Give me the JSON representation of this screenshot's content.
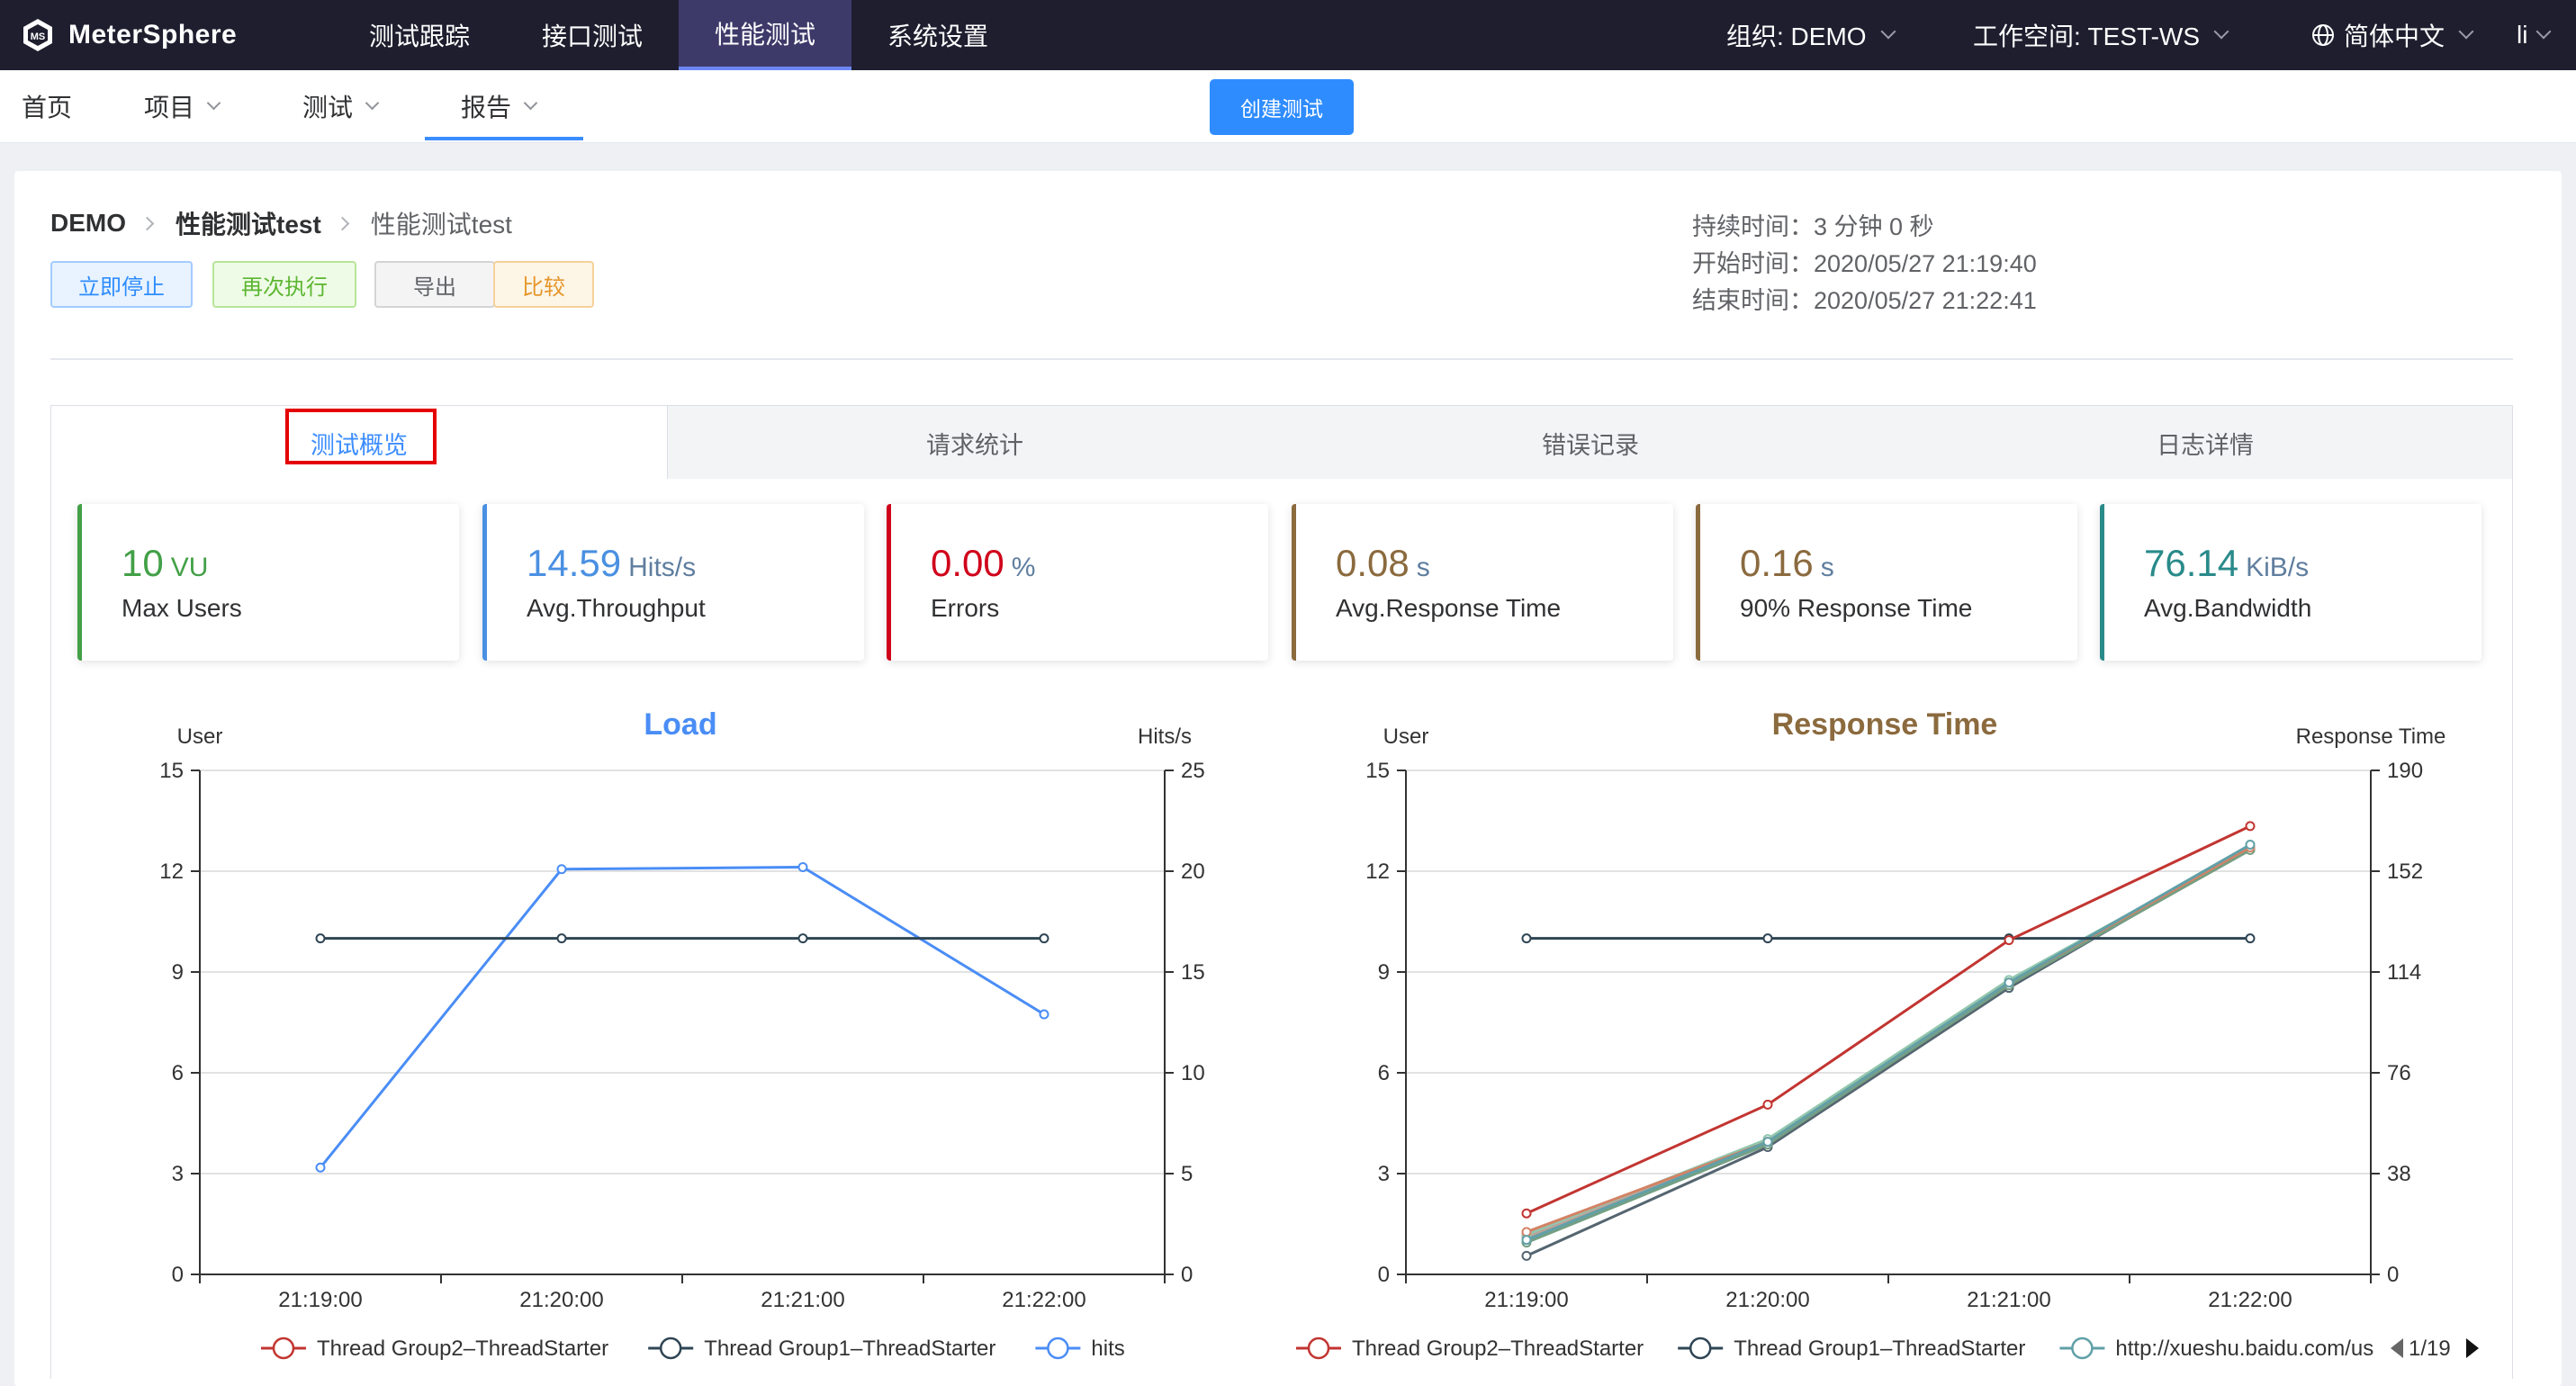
{
  "app": {
    "name": "MeterSphere"
  },
  "topnav": {
    "items": [
      {
        "label": "测试跟踪"
      },
      {
        "label": "接口测试"
      },
      {
        "label": "性能测试"
      },
      {
        "label": "系统设置"
      }
    ],
    "org": "组织: DEMO",
    "workspace": "工作空间: TEST-WS",
    "language": "简体中文",
    "user": "li"
  },
  "subnav": {
    "home": "首页",
    "project": "项目",
    "test": "测试",
    "report": "报告",
    "create": "创建测试"
  },
  "breadcrumb": {
    "project": "DEMO",
    "test": "性能测试test",
    "report": "性能测试test"
  },
  "actions": {
    "stop": "立即停止",
    "rerun": "再次执行",
    "export": "导出",
    "compare": "比较"
  },
  "times": {
    "duration_label": "持续时间：",
    "duration": "3 分钟 0 秒",
    "start_label": "开始时间：",
    "start": "2020/05/27 21:19:40",
    "end_label": "结束时间：",
    "end": "2020/05/27 21:22:41"
  },
  "tabs": [
    {
      "label": "测试概览"
    },
    {
      "label": "请求统计"
    },
    {
      "label": "错误记录"
    },
    {
      "label": "日志详情"
    }
  ],
  "metrics": [
    {
      "value": "10",
      "unit": "VU",
      "label": "Max Users",
      "color": "#43a047"
    },
    {
      "value": "14.59",
      "unit": "Hits/s",
      "label": "Avg.Throughput",
      "color": "#4a90e2"
    },
    {
      "value": "0.00",
      "unit": "%",
      "label": "Errors",
      "color": "#d0021b"
    },
    {
      "value": "0.08",
      "unit": "s",
      "label": "Avg.Response Time",
      "color": "#8b6a3e"
    },
    {
      "value": "0.16",
      "unit": "s",
      "label": "90% Response Time",
      "color": "#8b6a3e"
    },
    {
      "value": "76.14",
      "unit": "KiB/s",
      "label": "Avg.Bandwidth",
      "color": "#2a8a8a"
    }
  ],
  "chart_data": [
    {
      "type": "line",
      "title": "Load",
      "ylabel": "User",
      "y2label": "Hits/s",
      "x": [
        "21:19:00",
        "21:20:00",
        "21:21:00",
        "21:22:00"
      ],
      "ylim": [
        0,
        15
      ],
      "yticks": [
        0,
        3,
        6,
        9,
        12,
        15
      ],
      "y2lim": [
        0,
        25
      ],
      "y2ticks": [
        0,
        5,
        10,
        15,
        20,
        25
      ],
      "series": [
        {
          "name": "Thread Group2–ThreadStarter",
          "axis": "left",
          "color": "#c23531",
          "values": [
            10,
            10,
            10,
            10
          ],
          "hidden": true
        },
        {
          "name": "Thread Group1–ThreadStarter",
          "axis": "left",
          "color": "#2f4554",
          "values": [
            10,
            10,
            10,
            10
          ]
        },
        {
          "name": "hits",
          "axis": "right",
          "color": "#4a8df6",
          "values": [
            5.3,
            20.1,
            20.2,
            12.9
          ]
        }
      ],
      "legend": "bottom"
    },
    {
      "type": "line",
      "title": "Response Time",
      "ylabel": "User",
      "y2label": "Response Time",
      "x": [
        "21:19:00",
        "21:20:00",
        "21:21:00",
        "21:22:00"
      ],
      "ylim": [
        0,
        15
      ],
      "yticks": [
        0,
        3,
        6,
        9,
        12,
        15
      ],
      "y2lim": [
        0,
        190
      ],
      "y2ticks": [
        0,
        38,
        76,
        114,
        152,
        190
      ],
      "series": [
        {
          "name": "Thread Group2–ThreadStarter",
          "axis": "right",
          "color": "#c23531",
          "values": [
            23,
            64,
            126,
            169
          ]
        },
        {
          "name": "Thread Group1–ThreadStarter",
          "axis": "left",
          "color": "#2f4554",
          "values": [
            10,
            10,
            10,
            10
          ]
        },
        {
          "name": "http://xueshu.baidu.com/us",
          "axis": "right",
          "color": "#61a0a8",
          "values": [
            13,
            50,
            110,
            162
          ]
        },
        {
          "name": "",
          "axis": "right",
          "color": "#d48265",
          "values": [
            16,
            50,
            110,
            161
          ],
          "unlisted": true
        },
        {
          "name": "",
          "axis": "right",
          "color": "#91c7ae",
          "values": [
            15,
            51,
            111,
            161
          ],
          "unlisted": true
        },
        {
          "name": "",
          "axis": "right",
          "color": "#749f83",
          "values": [
            12,
            49,
            109,
            160
          ],
          "unlisted": true
        },
        {
          "name": "",
          "axis": "right",
          "color": "#546570",
          "values": [
            7,
            48,
            108,
            161
          ],
          "unlisted": true
        },
        {
          "name": "",
          "axis": "right",
          "color": "#bda29a",
          "values": [
            14,
            50,
            109,
            160
          ],
          "unlisted": true
        }
      ],
      "legend": "bottom",
      "legend_page": "1/19"
    }
  ]
}
